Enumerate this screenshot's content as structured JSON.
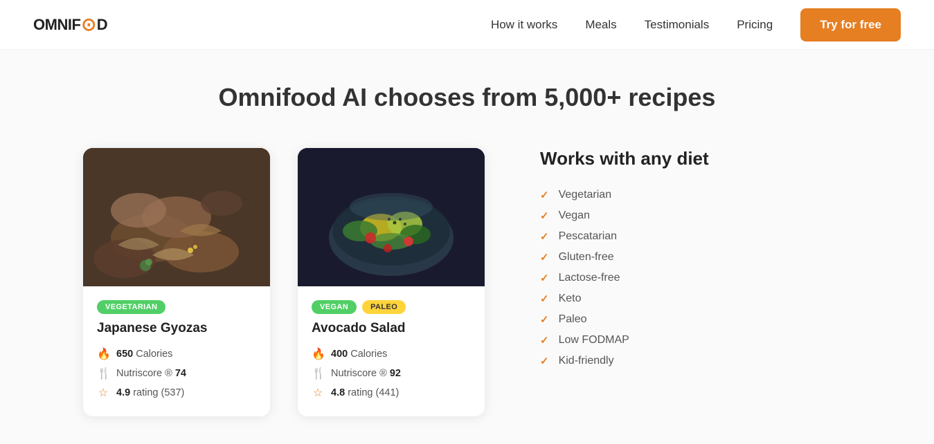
{
  "nav": {
    "logo": "OMNIF",
    "logo_icon": "⊙",
    "logo_end": "D",
    "links": [
      {
        "label": "How it works",
        "href": "#"
      },
      {
        "label": "Meals",
        "href": "#"
      },
      {
        "label": "Testimonials",
        "href": "#"
      },
      {
        "label": "Pricing",
        "href": "#"
      }
    ],
    "cta_label": "Try for free"
  },
  "section": {
    "heading": "Omnifood AI chooses from 5,000+ recipes",
    "meals": [
      {
        "id": "gyoza",
        "tags": [
          {
            "label": "Vegetarian",
            "class": "tag-veg"
          }
        ],
        "name": "Japanese Gyozas",
        "calories": "650",
        "calories_label": "Calories",
        "nutriscore_label": "Nutriscore ®",
        "nutriscore_value": "74",
        "rating": "4.9",
        "rating_label": "rating (537)"
      },
      {
        "id": "salad",
        "tags": [
          {
            "label": "Vegan",
            "class": "tag-vegan"
          },
          {
            "label": "Paleo",
            "class": "tag-paleo"
          }
        ],
        "name": "Avocado Salad",
        "calories": "400",
        "calories_label": "Calories",
        "nutriscore_label": "Nutriscore ®",
        "nutriscore_value": "92",
        "rating": "4.8",
        "rating_label": "rating (441)"
      }
    ],
    "diet": {
      "heading": "Works with any diet",
      "items": [
        "Vegetarian",
        "Vegan",
        "Pescatarian",
        "Gluten-free",
        "Lactose-free",
        "Keto",
        "Paleo",
        "Low FODMAP",
        "Kid-friendly"
      ]
    }
  }
}
